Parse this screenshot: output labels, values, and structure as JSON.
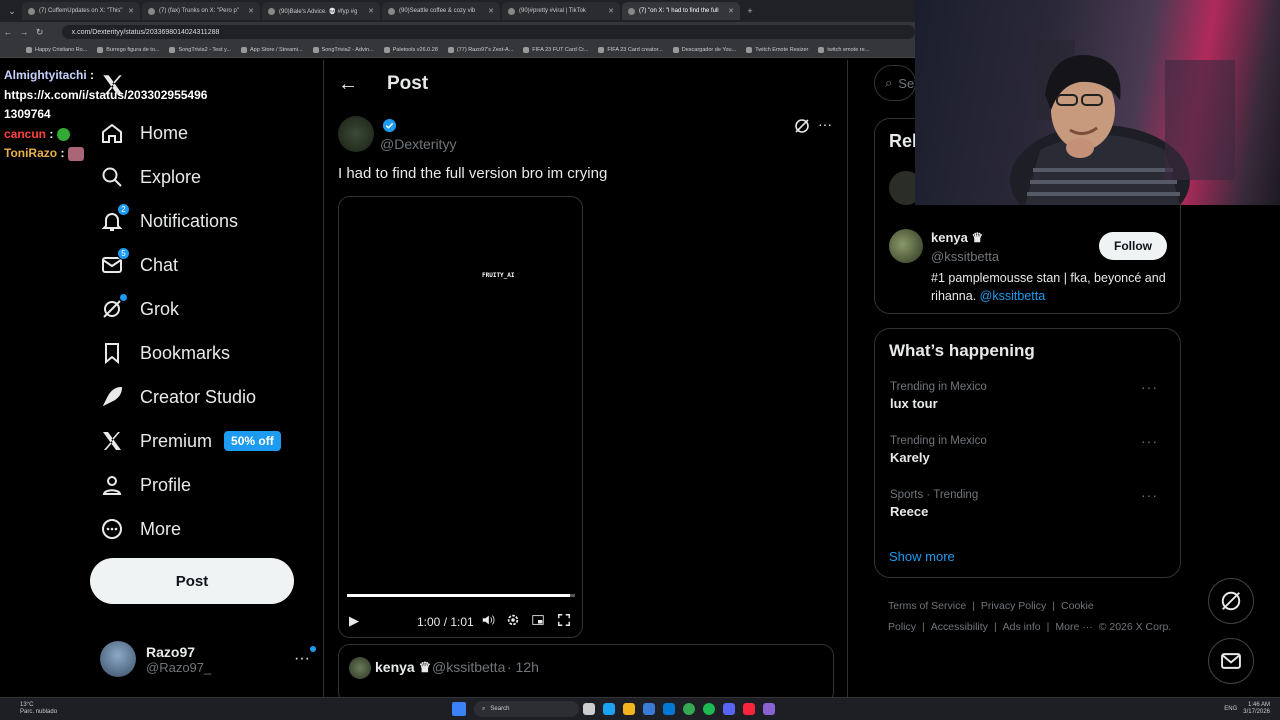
{
  "browser": {
    "tabs": [
      {
        "title": "(7) CuffemUpdates on X: \"This\"",
        "active": false
      },
      {
        "title": "(7) (fax) Trunks on X: \"Pero p\"",
        "active": false
      },
      {
        "title": "(90)Bale's Advice. 💀 #fyp #g",
        "active": false
      },
      {
        "title": "(90)Seattle coffee & cozy vib",
        "active": false
      },
      {
        "title": "(90)#pretty #viral | TikTok",
        "active": false
      },
      {
        "title": "(7) \"on X: \"I had to find the full",
        "active": true
      }
    ],
    "new_tab_label": "+",
    "url": "x.com/Dexterityy/status/2033698014024311288",
    "bookmarks": [
      "Happy Cristiano Ro...",
      "Burrego figura de to...",
      "SongTrivia2 - Test y...",
      "App Store / Streami...",
      "SongTrivia2 - Advin...",
      "Paletools v26.0.28",
      "(77) Razo97's Zest-A...",
      "FIFA 23 FUT Card Cr...",
      "FIFA 23 Card creator...",
      "Descargador de You...",
      "Twitch Emote Resizer",
      "twitch emote re..."
    ]
  },
  "chat_overlay": {
    "lines": [
      {
        "user": "Almightyitachi",
        "sep": " :",
        "text": "",
        "color": "#c9d3ff"
      },
      {
        "user": "",
        "sep": "",
        "text": "https://x.com/i/status/2033029554961309764",
        "color": "#ffffff"
      },
      {
        "user": "cancun",
        "sep": " :",
        "text": "",
        "color": "#ff4040"
      },
      {
        "user": "ToniRazo",
        "sep": " :",
        "text": "",
        "color": "#e8b04a"
      }
    ]
  },
  "nav": {
    "items": [
      {
        "label": "Home",
        "icon": "home-icon"
      },
      {
        "label": "Explore",
        "icon": "search-icon"
      },
      {
        "label": "Notifications",
        "icon": "bell-icon",
        "badge": "2"
      },
      {
        "label": "Chat",
        "icon": "mail-icon",
        "badge": "5"
      },
      {
        "label": "Grok",
        "icon": "grok-icon",
        "dot": true
      },
      {
        "label": "Bookmarks",
        "icon": "bookmark-icon"
      },
      {
        "label": "Creator Studio",
        "icon": "rocket-icon"
      },
      {
        "label": "Premium",
        "icon": "x-logo-icon",
        "pill": "50% off"
      },
      {
        "label": "Profile",
        "icon": "person-icon"
      },
      {
        "label": "More",
        "icon": "more-circle-icon"
      }
    ],
    "post_button": "Post",
    "account": {
      "name": "Razo97",
      "handle": "@Razo97_"
    }
  },
  "post": {
    "header_title": "Post",
    "author_handle": "@Dexterityy",
    "text": "I had to find the full version bro im crying",
    "video": {
      "watermark": "FRUITY_AI",
      "time": "1:00 / 1:01",
      "progress": 0.98
    },
    "reply": {
      "name": "kenya ♛",
      "handle": "@kssitbetta",
      "time": "· 12h"
    }
  },
  "sidebar": {
    "search_placeholder": "Se",
    "relevant_title": "Rel",
    "relevant_user": {
      "name": "kenya ♛",
      "handle": "@kssitbetta",
      "bio": "#1 pamplemousse stan | fka, beyoncé and rihanna.",
      "bio_link": "@kssitbetta",
      "follow": "Follow"
    },
    "happening_title": "What’s happening",
    "trends": [
      {
        "context": "Trending in Mexico",
        "name": "lux tour"
      },
      {
        "context": "Trending in Mexico",
        "name": "Karely"
      },
      {
        "context": "Sports · Trending",
        "name": "Reece"
      }
    ],
    "show_more": "Show more",
    "footer": [
      "Terms of Service",
      "|",
      "Privacy Policy",
      "|",
      "Cookie Policy",
      "|",
      "Accessibility",
      "|",
      "Ads info",
      "|",
      "More ···",
      "© 2026 X Corp."
    ]
  },
  "taskbar": {
    "weather": "13°C",
    "weather_desc": "Parc. nublado",
    "search": "Search",
    "lang": "ENG",
    "time": "1:46 AM",
    "date": "3/17/2026"
  },
  "colors": {
    "accent": "#1d9bf0",
    "bg": "#000000",
    "border": "#2f3336",
    "muted": "#71767b"
  }
}
